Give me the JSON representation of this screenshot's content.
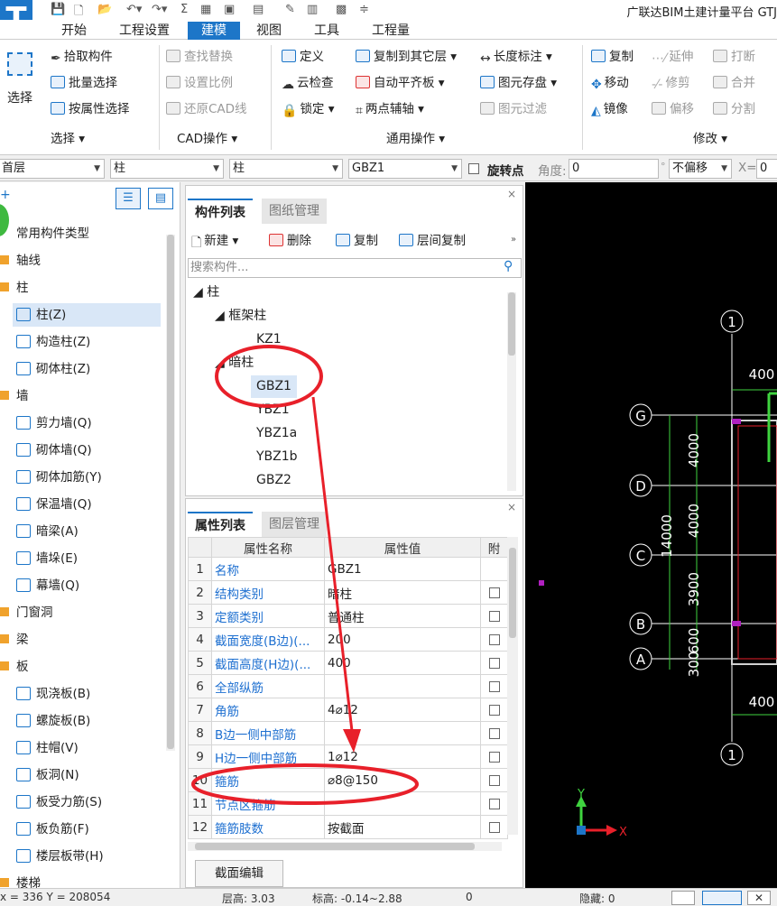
{
  "app": {
    "title": "广联达BIM土建计量平台 GTJ",
    "logo_letter": "T",
    "quick_access": [
      "save-icon",
      "doc-icon",
      "open-icon",
      "undo-icon",
      "redo-icon",
      "sum-icon",
      "icon-a",
      "icon-b",
      "icon-c",
      "edit-icon",
      "grid-icon",
      "export-icon"
    ]
  },
  "tabs": [
    "开始",
    "工程设置",
    "建模",
    "视图",
    "工具",
    "工程量"
  ],
  "active_tab": "建模",
  "ribbon": {
    "select_big": "选择",
    "select_group": {
      "items": [
        "拾取构件",
        "批量选择",
        "按属性选择"
      ],
      "label": "选择 ▾"
    },
    "cad_group": {
      "items": [
        "查找替换",
        "设置比例",
        "还原CAD线"
      ],
      "label": "CAD操作 ▾"
    },
    "general_group": {
      "col1": [
        "定义",
        "云检查",
        "锁定 ▾"
      ],
      "col2": [
        "复制到其它层 ▾",
        "自动平齐板 ▾",
        "两点辅轴 ▾"
      ],
      "col3": [
        "长度标注 ▾",
        "图元存盘 ▾",
        "图元过滤"
      ],
      "label": "通用操作 ▾"
    },
    "modify_group": {
      "col1": [
        "复制",
        "移动",
        "镜像"
      ],
      "col2": [
        "延伸",
        "修剪",
        "偏移"
      ],
      "col3": [
        "打断",
        "合并",
        "分割"
      ],
      "label": "修改 ▾"
    }
  },
  "propbar": {
    "floor": "首层",
    "type1": "柱",
    "type2": "柱",
    "component": "GBZ1",
    "rotate_label": "旋转点",
    "angle_label": "角度:",
    "angle_value": "0",
    "offset_mode": "不偏移",
    "x_label": "X=",
    "x_value": "0"
  },
  "left_tree": {
    "root": "常用构件类型",
    "items": [
      {
        "label": "轴线",
        "level": 0
      },
      {
        "label": "柱",
        "level": 0
      },
      {
        "label": "柱(Z)",
        "level": 1,
        "selected": true
      },
      {
        "label": "构造柱(Z)",
        "level": 1
      },
      {
        "label": "砌体柱(Z)",
        "level": 1
      },
      {
        "label": "墙",
        "level": 0
      },
      {
        "label": "剪力墙(Q)",
        "level": 1
      },
      {
        "label": "砌体墙(Q)",
        "level": 1
      },
      {
        "label": "砌体加筋(Y)",
        "level": 1
      },
      {
        "label": "保温墙(Q)",
        "level": 1
      },
      {
        "label": "暗梁(A)",
        "level": 1
      },
      {
        "label": "墙垛(E)",
        "level": 1
      },
      {
        "label": "幕墙(Q)",
        "level": 1
      },
      {
        "label": "门窗洞",
        "level": 0
      },
      {
        "label": "梁",
        "level": 0
      },
      {
        "label": "板",
        "level": 0
      },
      {
        "label": "现浇板(B)",
        "level": 1
      },
      {
        "label": "螺旋板(B)",
        "level": 1
      },
      {
        "label": "柱帽(V)",
        "level": 1
      },
      {
        "label": "板洞(N)",
        "level": 1
      },
      {
        "label": "板受力筋(S)",
        "level": 1
      },
      {
        "label": "板负筋(F)",
        "level": 1
      },
      {
        "label": "楼层板带(H)",
        "level": 1
      },
      {
        "label": "楼梯",
        "level": 0
      }
    ]
  },
  "component_panel": {
    "tabs": [
      "构件列表",
      "图纸管理"
    ],
    "toolbar": [
      "新建 ▾",
      "删除",
      "复制",
      "层间复制"
    ],
    "search_placeholder": "搜索构件...",
    "tree": [
      {
        "label": "◢ 柱",
        "level": 0
      },
      {
        "label": "◢ 框架柱",
        "level": 1
      },
      {
        "label": "KZ1",
        "level": 2
      },
      {
        "label": "◢ 暗柱",
        "level": 1
      },
      {
        "label": "GBZ1",
        "level": 2,
        "selected": true
      },
      {
        "label": "YBZ1",
        "level": 2
      },
      {
        "label": "YBZ1a",
        "level": 2
      },
      {
        "label": "YBZ1b",
        "level": 2
      },
      {
        "label": "GBZ2",
        "level": 2
      }
    ]
  },
  "property_panel": {
    "tabs": [
      "属性列表",
      "图层管理"
    ],
    "headers": [
      "属性名称",
      "属性值",
      "附"
    ],
    "rows": [
      {
        "n": "1",
        "name": "名称",
        "value": "GBZ1",
        "check": false
      },
      {
        "n": "2",
        "name": "结构类别",
        "value": "暗柱",
        "check": true
      },
      {
        "n": "3",
        "name": "定额类别",
        "value": "普通柱",
        "check": true
      },
      {
        "n": "4",
        "name": "截面宽度(B边)(...",
        "value": "200",
        "check": true
      },
      {
        "n": "5",
        "name": "截面高度(H边)(...",
        "value": "400",
        "check": true
      },
      {
        "n": "6",
        "name": "全部纵筋",
        "value": "",
        "check": true
      },
      {
        "n": "7",
        "name": "角筋",
        "value": "4⌀12",
        "check": true
      },
      {
        "n": "8",
        "name": "B边一侧中部筋",
        "value": "",
        "check": true
      },
      {
        "n": "9",
        "name": "H边一侧中部筋",
        "value": "1⌀12",
        "check": true
      },
      {
        "n": "10",
        "name": "箍筋",
        "value": "⌀8@150",
        "check": true
      },
      {
        "n": "11",
        "name": "节点区箍筋",
        "value": "",
        "check": true
      },
      {
        "n": "12",
        "name": "箍筋肢数",
        "value": "按截面",
        "check": true
      }
    ],
    "section_edit_button": "截面编辑"
  },
  "canvas": {
    "axes_top": [
      "1"
    ],
    "axes_left": [
      "G",
      "D",
      "C",
      "B",
      "A"
    ],
    "axes_bottom": [
      "1"
    ],
    "dims_vertical": [
      "4000",
      "4000",
      "3900",
      "600",
      "300"
    ],
    "dim_total": "14000",
    "dim_top": "400",
    "dim_bottom": "400",
    "ucs_x": "X",
    "ucs_y": "Y"
  },
  "status": {
    "coords": "x = 336  Y = 208054",
    "floor_height": "层高: 3.03",
    "elevation": "标高: -0.14~2.88",
    "hidden": "隐藏: 0",
    "extra": "0"
  },
  "colors": {
    "accent": "#1d76c8",
    "annotation": "#e8202a",
    "canvas_bg": "#000000",
    "axis_line": "#ffffff",
    "grid_line": "#3fd33f",
    "wall": "#e0e0e0",
    "magenta": "#b020c0"
  }
}
